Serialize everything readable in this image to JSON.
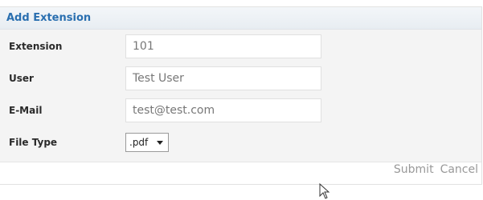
{
  "dialog": {
    "title": "Add Extension"
  },
  "form": {
    "extension": {
      "label": "Extension",
      "value": "101"
    },
    "user": {
      "label": "User",
      "value": "Test User"
    },
    "email": {
      "label": "E-Mail",
      "value": "test@test.com"
    },
    "file_type": {
      "label": "File Type",
      "selected": ".pdf"
    }
  },
  "actions": {
    "submit_label": "Submit",
    "cancel_label": "Cancel"
  },
  "icons": {
    "dropdown": "chevron-down-icon",
    "pointer": "mouse-cursor-icon"
  }
}
